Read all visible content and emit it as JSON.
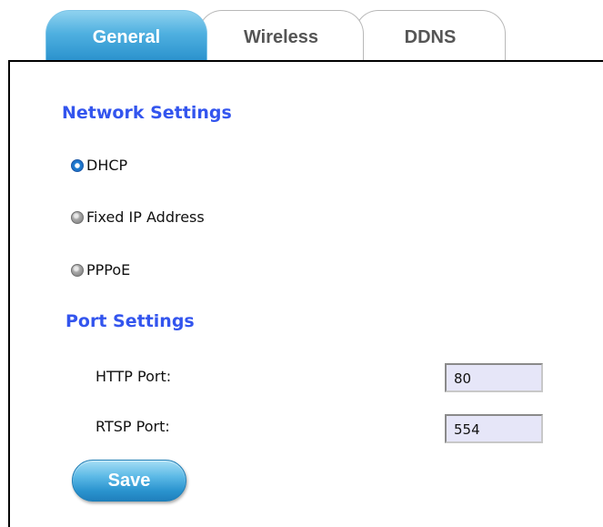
{
  "tabs": [
    {
      "label": "General",
      "active": true
    },
    {
      "label": "Wireless",
      "active": false
    },
    {
      "label": "DDNS",
      "active": false
    }
  ],
  "network_settings": {
    "title": "Network Settings",
    "options": [
      {
        "label": "DHCP",
        "selected": true
      },
      {
        "label": "Fixed IP Address",
        "selected": false
      },
      {
        "label": "PPPoE",
        "selected": false
      }
    ]
  },
  "port_settings": {
    "title": "Port Settings",
    "http_label": "HTTP Port:",
    "http_value": "80",
    "rtsp_label": "RTSP Port:",
    "rtsp_value": "554"
  },
  "save_label": "Save",
  "colors": {
    "accent": "#2a92cd",
    "section_title": "#3355ee",
    "input_bg": "#e6e6f8"
  }
}
